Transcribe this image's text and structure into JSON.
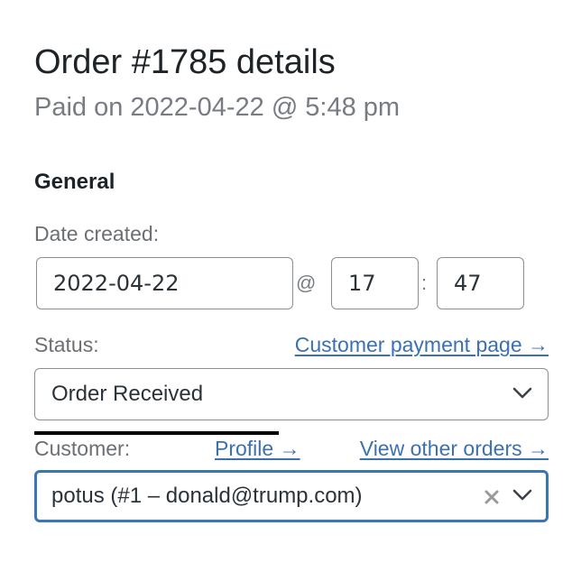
{
  "header": {
    "title": "Order #1785 details",
    "paid_line": "Paid on 2022-04-22 @ 5:48 pm"
  },
  "general": {
    "heading": "General",
    "date_created": {
      "label": "Date created:",
      "date_value": "2022-04-22",
      "at_separator": "@",
      "hour_value": "17",
      "time_separator": ":",
      "minute_value": "47"
    },
    "status": {
      "label": "Status:",
      "link_label": "Customer payment page →",
      "selected": "Order Received",
      "icon": "chevron-down-icon"
    },
    "customer": {
      "label": "Customer:",
      "profile_link": "Profile →",
      "orders_link": "View other orders →",
      "selected": "potus (#1 – donald@trump.com)",
      "clear_icon": "close-icon",
      "icon": "chevron-down-icon"
    }
  },
  "colors": {
    "link": "#3b71b0",
    "focus_border": "#3a76b3",
    "label": "#6c6f73",
    "text": "#1d2327"
  }
}
